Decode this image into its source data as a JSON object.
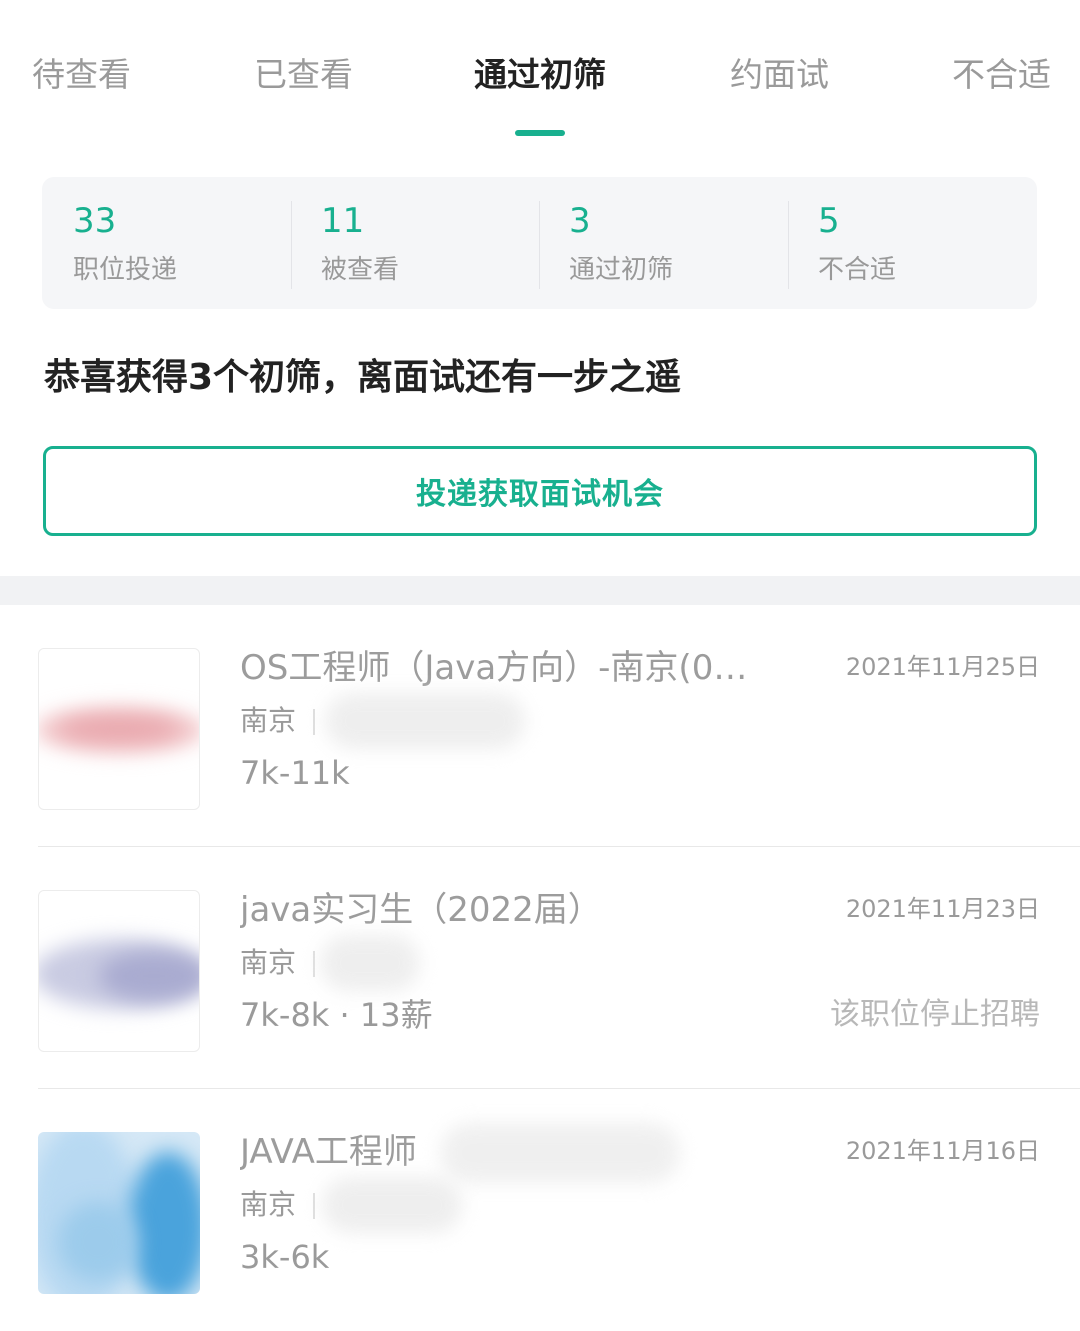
{
  "tabs": [
    {
      "label": "待查看"
    },
    {
      "label": "已查看"
    },
    {
      "label": "通过初筛"
    },
    {
      "label": "约面试"
    },
    {
      "label": "不合适"
    }
  ],
  "stats": [
    {
      "count": "33",
      "label": "职位投递"
    },
    {
      "count": "11",
      "label": "被查看"
    },
    {
      "count": "3",
      "label": "通过初筛"
    },
    {
      "count": "5",
      "label": "不合适"
    }
  ],
  "headline": "恭喜获得3个初筛，离面试还有一步之遥",
  "cta_label": "投递获取面试机会",
  "jobs": [
    {
      "title": "OS工程师（Java方向）-南京(0…",
      "date": "2021年11月25日",
      "city": "南京",
      "salary": "7k-11k",
      "status": ""
    },
    {
      "title": "java实习生（2022届）",
      "date": "2021年11月23日",
      "city": "南京",
      "salary": "7k-8k · 13薪",
      "status": "该职位停止招聘"
    },
    {
      "title": "JAVA工程师",
      "date": "2021年11月16日",
      "city": "南京",
      "salary": "3k-6k",
      "status": ""
    }
  ],
  "colors": {
    "accent": "#18b08f",
    "text_primary": "#222222",
    "text_muted": "#9a9a9a"
  }
}
